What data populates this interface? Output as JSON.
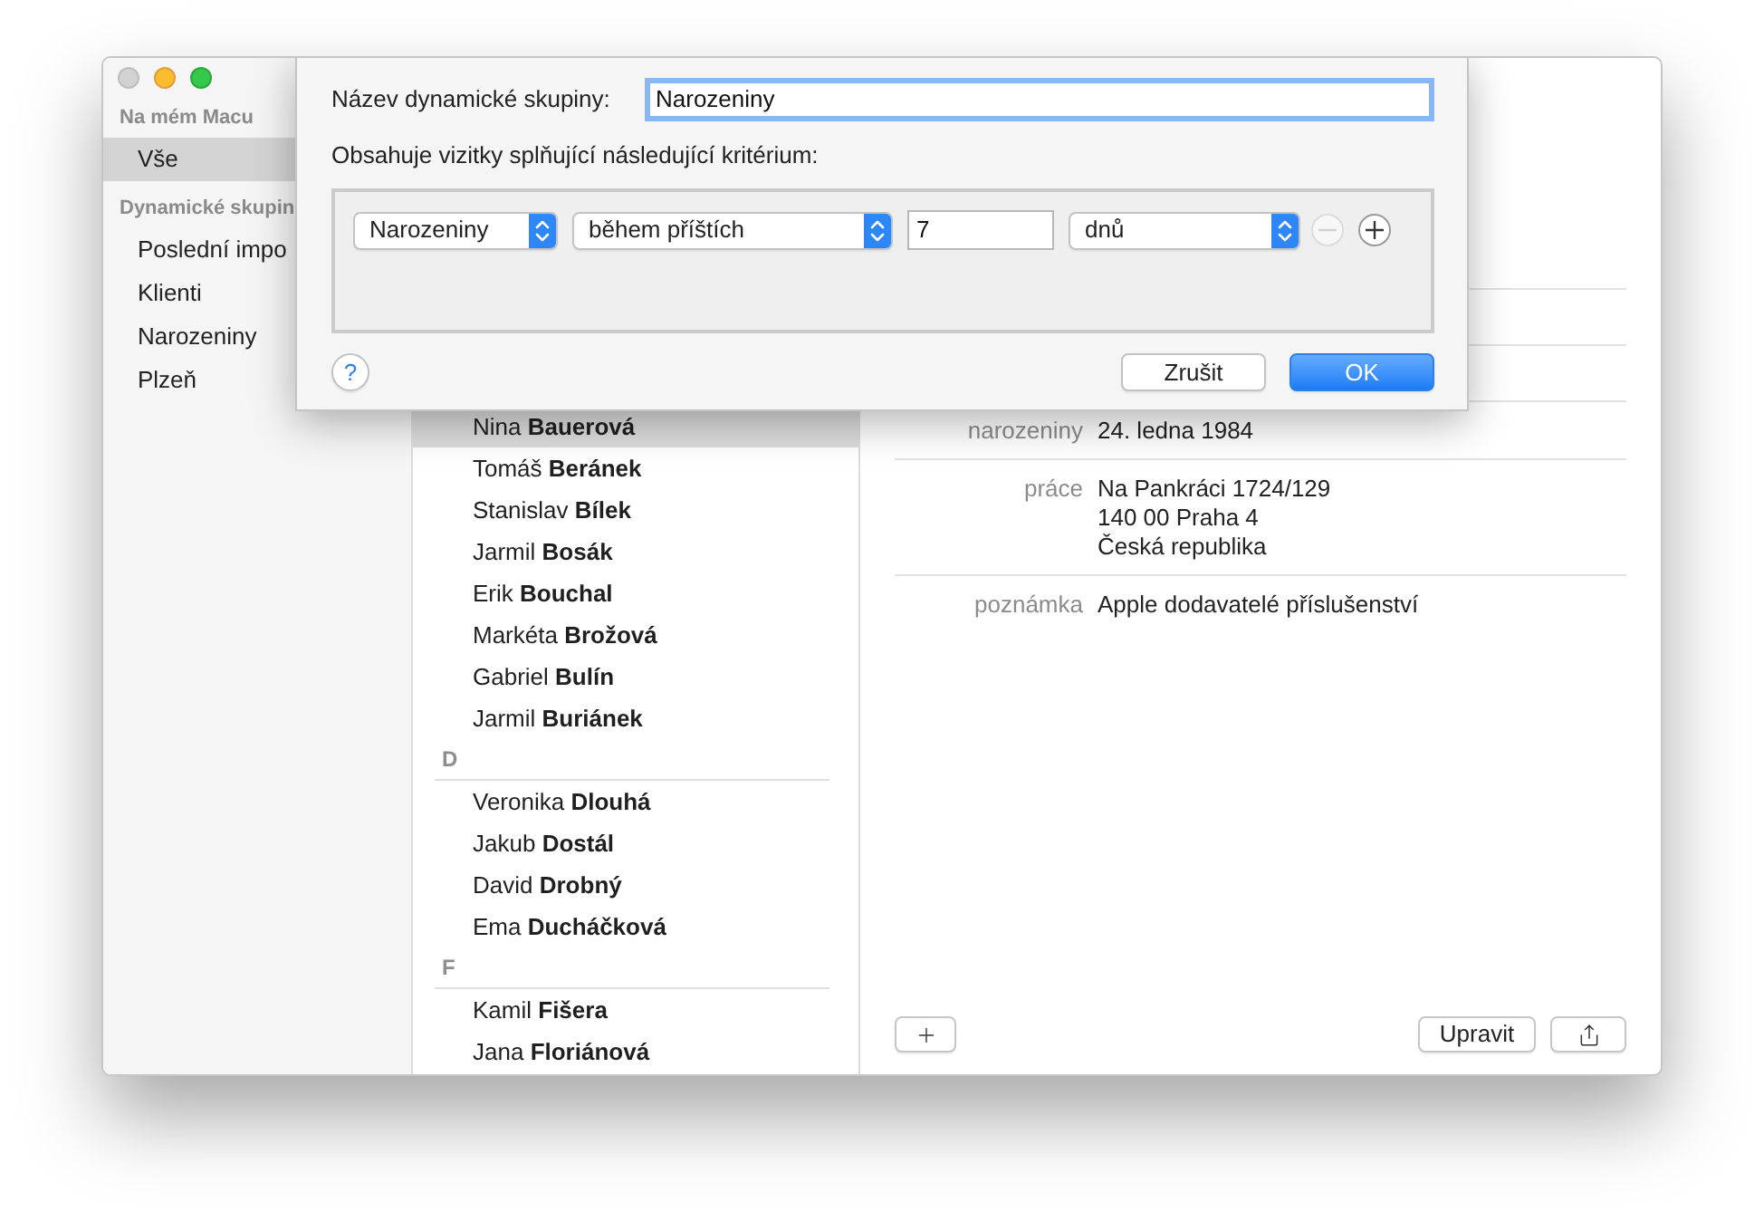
{
  "window": {
    "close_disabled": true
  },
  "sidebar": {
    "sections": [
      {
        "heading": "Na mém Macu",
        "items": [
          {
            "label": "Vše",
            "selected": true
          }
        ]
      },
      {
        "heading": "Dynamické skupin",
        "items": [
          {
            "label": "Poslední impo",
            "selected": false
          },
          {
            "label": "Klienti",
            "selected": false
          },
          {
            "label": "Narozeniny",
            "selected": false
          },
          {
            "label": "Plzeň",
            "selected": false
          }
        ]
      }
    ]
  },
  "contacts": {
    "rows": [
      {
        "kind": "contact",
        "name": "Nina **Bauerová**",
        "selected": true
      },
      {
        "kind": "contact",
        "name": "Tomáš **Beránek**",
        "selected": false
      },
      {
        "kind": "contact",
        "name": "Stanislav **Bílek**",
        "selected": false
      },
      {
        "kind": "contact",
        "name": "Jarmil **Bosák**",
        "selected": false
      },
      {
        "kind": "contact",
        "name": "Erik **Bouchal**",
        "selected": false
      },
      {
        "kind": "contact",
        "name": "Markéta **Brožová**",
        "selected": false
      },
      {
        "kind": "contact",
        "name": "Gabriel **Bulín**",
        "selected": false
      },
      {
        "kind": "contact",
        "name": "Jarmil **Buriánek**",
        "selected": false
      },
      {
        "kind": "section",
        "letter": "D"
      },
      {
        "kind": "contact",
        "name": "Veronika **Dlouhá**",
        "selected": false
      },
      {
        "kind": "contact",
        "name": "Jakub **Dostál**",
        "selected": false
      },
      {
        "kind": "contact",
        "name": "David **Drobný**",
        "selected": false
      },
      {
        "kind": "contact",
        "name": "Ema **Ducháčková**",
        "selected": false
      },
      {
        "kind": "section",
        "letter": "F"
      },
      {
        "kind": "contact",
        "name": "Kamil **Fišera**",
        "selected": false
      },
      {
        "kind": "contact",
        "name": "Jana **Floriánová**",
        "selected": false
      }
    ]
  },
  "details": {
    "fields": [
      {
        "label": "narozeniny",
        "lines": [
          "24. ledna 1984"
        ]
      },
      {
        "label": "práce",
        "lines": [
          "Na Pankráci 1724/129",
          "140 00 Praha 4",
          "Česká republika"
        ]
      },
      {
        "label": "poznámka",
        "lines": [
          "Apple dodavatelé příslušenství"
        ]
      }
    ],
    "buttons": [
      {
        "kind": "add"
      },
      {
        "kind": "edit",
        "label": "Upravit"
      },
      {
        "kind": "share"
      }
    ]
  },
  "dialog": {
    "name_label": "Název dynamické skupiny:",
    "name_field": {
      "value": "Narozeniny",
      "focused": true
    },
    "criteria_label": "Obsahuje vizitky splňující následující kritérium:",
    "criteria": [
      {
        "field": "Narozeniny",
        "operator": "během příštích",
        "value": "7",
        "unit": "dnů",
        "remove_disabled": true
      }
    ],
    "help": "?",
    "buttons": [
      {
        "label": "Zrušit",
        "default": false
      },
      {
        "label": "OK",
        "default": true
      }
    ]
  }
}
